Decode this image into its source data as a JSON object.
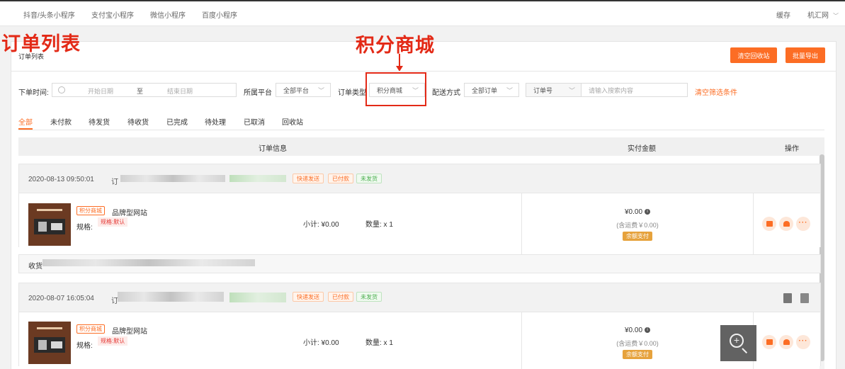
{
  "topnav": {
    "tabs": [
      "抖音/头条小程序",
      "支付宝小程序",
      "微信小程序",
      "百度小程序"
    ],
    "cache": "缓存",
    "user": "机汇网"
  },
  "annotations": {
    "order_list": "订单列表",
    "points_mall": "积分商城"
  },
  "page": {
    "title": "订单列表",
    "btn_clear_recycle": "清空回收站",
    "btn_export": "批量导出"
  },
  "filters": {
    "time_label": "下单时间:",
    "start_placeholder": "开始日期",
    "to": "至",
    "end_placeholder": "结束日期",
    "platform_label": "所属平台",
    "platform_value": "全部平台",
    "type_label": "订单类型",
    "type_value": "积分商城",
    "delivery_label": "配送方式",
    "delivery_value": "全部订单",
    "search_field": "订单号",
    "search_placeholder": "请输入搜索内容",
    "clear": "清空筛选条件"
  },
  "status_tabs": [
    "全部",
    "未付款",
    "待发货",
    "待收货",
    "已完成",
    "待处理",
    "已取消",
    "回收站"
  ],
  "table_headers": {
    "info": "订单信息",
    "amount": "实付金额",
    "action": "操作"
  },
  "orders": [
    {
      "date": "2020-08-13 09:50:01",
      "order_prefix": "订",
      "tags": [
        "快递发送",
        "已付款",
        "未发货"
      ],
      "product_tag": "积分商城",
      "product_name": "品牌型网站",
      "spec_label": "规格:",
      "spec_value": "规格:默认",
      "subtotal": "小计: ¥0.00",
      "qty": "数量: x 1",
      "amount": "¥0.00",
      "shipping": "(含运费￥0.00)",
      "pay_method": "余额支付",
      "footer_prefix": "收货"
    },
    {
      "date": "2020-08-07 16:05:04",
      "order_prefix": "订",
      "tags": [
        "快递发送",
        "已付款",
        "未发货"
      ],
      "product_tag": "积分商城",
      "product_name": "品牌型网站",
      "spec_label": "规格:",
      "spec_value": "规格:默认",
      "subtotal": "小计: ¥0.00",
      "qty": "数量: x 1",
      "amount": "¥0.00",
      "shipping": "(含运费￥0.00)",
      "pay_method": "余额支付",
      "footer_prefix": ""
    }
  ]
}
